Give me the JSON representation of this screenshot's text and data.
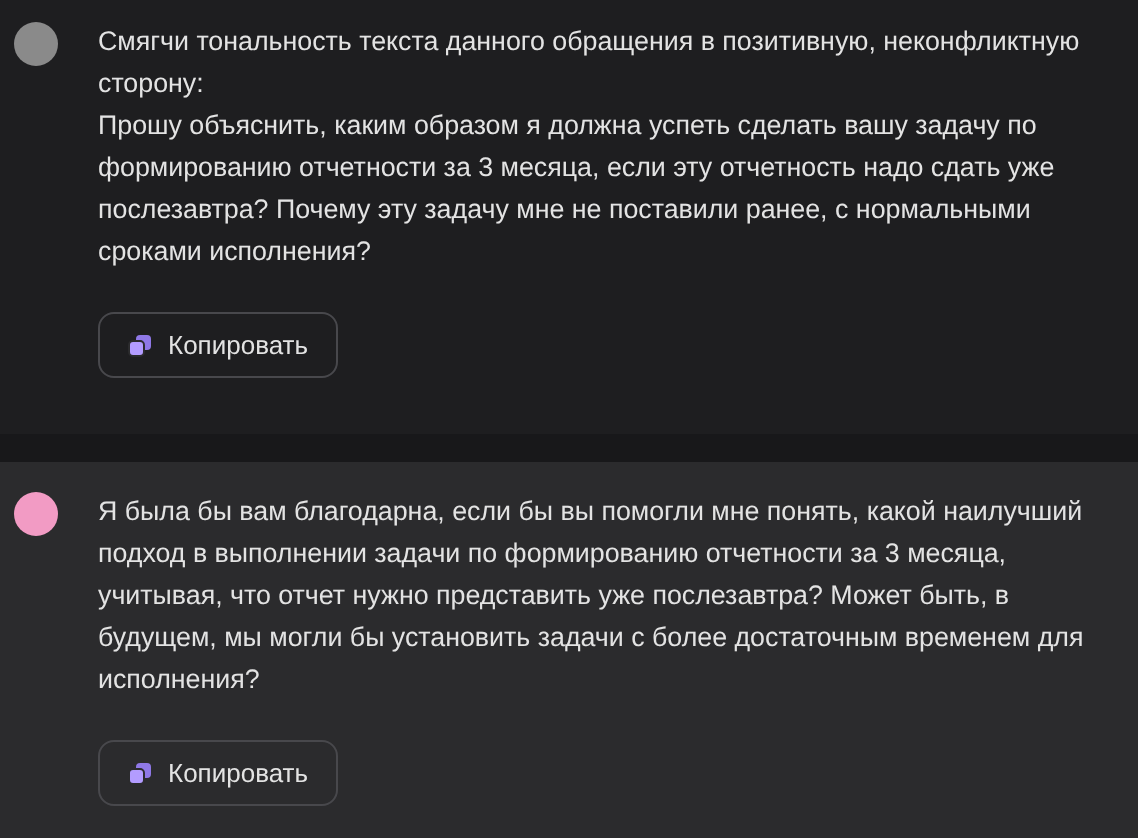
{
  "messages": [
    {
      "kind": "user",
      "color": "#8a8a8a",
      "paragraphs": [
        "Смягчи тональность текста данного обращения в позитивную, неконфликтную сторону:",
        "Прошу объяснить, каким образом я должна успеть сделать вашу задачу по формированию отчетности за 3 месяца, если эту отчетность надо сдать уже послезавтра? Почему эту задачу мне не поставили ранее, с нормальными сроками исполнения?"
      ],
      "copy_button": "Копировать"
    },
    {
      "kind": "assistant",
      "color": "#f29bc4",
      "paragraphs": [
        "Я была бы вам благодарна, если бы вы помогли мне понять, какой наилучший подход в выполнении задачи по формированию отчетности за 3 месяца, учитывая, что отчет нужно представить уже послезавтра? Может быть, в будущем, мы могли бы установить задачи с более достаточным временем для исполнения?"
      ],
      "copy_button": "Копировать"
    }
  ]
}
